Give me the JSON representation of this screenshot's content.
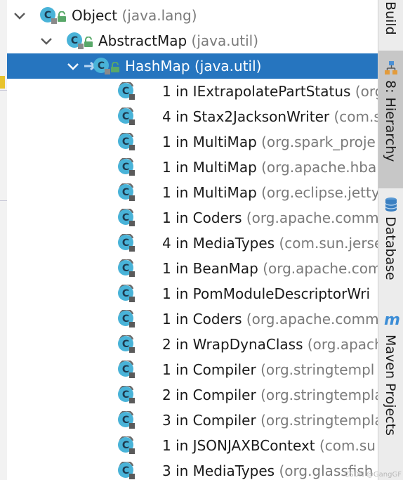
{
  "tree": {
    "nodes": [
      {
        "name": "Object",
        "pkg": "(java.lang)",
        "expanded": true,
        "level": 0,
        "selected": false
      },
      {
        "name": "AbstractMap",
        "pkg": "(java.util)",
        "expanded": true,
        "level": 1,
        "selected": false
      },
      {
        "name": "HashMap",
        "pkg": "(java.util)",
        "expanded": true,
        "level": 2,
        "selected": true
      },
      {
        "name": "1 in IExtrapolatePartStatus",
        "pkg": "(org",
        "level": 3
      },
      {
        "name": "4 in Stax2JacksonWriter",
        "pkg": "(com.s",
        "level": 3
      },
      {
        "name": "1 in MultiMap",
        "pkg": "(org.spark_proje",
        "level": 3
      },
      {
        "name": "1 in MultiMap",
        "pkg": "(org.apache.hba",
        "level": 3
      },
      {
        "name": "1 in MultiMap",
        "pkg": "(org.eclipse.jetty",
        "level": 3
      },
      {
        "name": "1 in Coders",
        "pkg": "(org.apache.comm",
        "level": 3
      },
      {
        "name": "4 in MediaTypes",
        "pkg": "(com.sun.jerse",
        "level": 3
      },
      {
        "name": "1 in BeanMap",
        "pkg": "(org.apache.com",
        "level": 3
      },
      {
        "name": "1 in PomModuleDescriptorWri",
        "pkg": "",
        "level": 3
      },
      {
        "name": "1 in Coders",
        "pkg": "(org.apache.comm",
        "level": 3
      },
      {
        "name": "2 in WrapDynaClass",
        "pkg": "(org.apach",
        "level": 3
      },
      {
        "name": "1 in Compiler",
        "pkg": "(org.stringtempl",
        "level": 3
      },
      {
        "name": "2 in Compiler",
        "pkg": "(org.stringtempla",
        "level": 3
      },
      {
        "name": "3 in Compiler",
        "pkg": "(org.stringtempla",
        "level": 3
      },
      {
        "name": "1 in JSONJAXBContext",
        "pkg": "(com.su",
        "level": 3
      },
      {
        "name": "3 in MediaTypes",
        "pkg": "(org.glassfish",
        "level": 3
      }
    ]
  },
  "toolbar": {
    "build_label": "Build",
    "hierarchy_label": "8: Hierarchy",
    "database_label": "Database",
    "maven_label": "Maven Projects"
  },
  "colors": {
    "selection": "#2675bf",
    "class_icon": "#49b3d8",
    "lock": "#59a869",
    "package_text": "#7a7a7a"
  },
  "watermark": "CSDN @GangGF"
}
